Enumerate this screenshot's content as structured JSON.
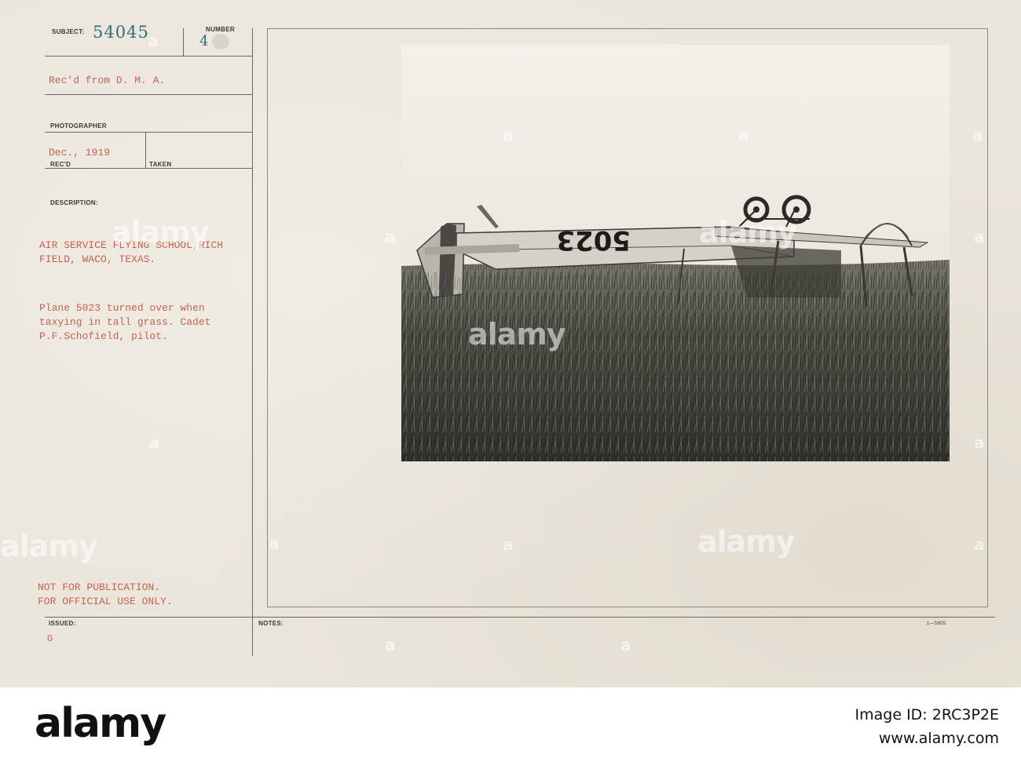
{
  "card": {
    "subject_label": "SUBJECT:",
    "subject_number": "54045",
    "number_label": "NUMBER",
    "number_value": "4",
    "received_from": "Rec'd from D. M. A.",
    "photographer_label": "PHOTOGRAPHER",
    "received_date": "Dec., 1919",
    "recd_label": "REC'D",
    "taken_label": "TAKEN",
    "description_label": "DESCRIPTION:",
    "description_lines": [
      "AIR SERVICE FLYING SCHOOL,RICH",
      "FIELD, WACO, TEXAS."
    ],
    "caption_lines": [
      "Plane 5023 turned over when",
      "taxying in tall grass. Cadet",
      "P.F.Schofield, pilot."
    ],
    "restriction_lines": [
      "NOT FOR PUBLICATION.",
      "FOR OFFICIAL USE ONLY."
    ],
    "issued_label": "ISSUED:",
    "issued_value": "G",
    "notes_label": "NOTES:",
    "form_number": "1—5605"
  },
  "photo": {
    "aircraft_number": "5023"
  },
  "watermark": {
    "text": "alamy",
    "small_marks": "a"
  },
  "footer": {
    "logo": "alamy",
    "image_id": "Image ID: 2RC3P2E",
    "url": "www.alamy.com"
  },
  "colors": {
    "card_background": "#ebe6dc",
    "typed_text": "#c8624f",
    "stamp_number": "#2f6f7a",
    "rules": "#6b665e"
  }
}
